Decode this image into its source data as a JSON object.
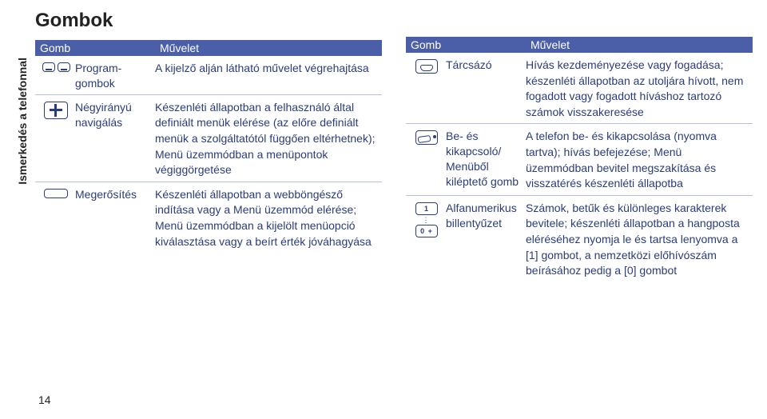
{
  "sideLabel": "Ismerkedés a telefonnal",
  "title": "Gombok",
  "headers": {
    "gomb": "Gomb",
    "muvelet": "Művelet"
  },
  "left": {
    "rows": [
      {
        "label": "Program-gombok",
        "op": "A kijelző alján látható művelet végrehajtása"
      },
      {
        "label": "Négyirányú navigálás",
        "op": "Készenléti állapotban a felhasználó által definiált menük elérése (az előre definiált menük a szolgáltatótól függően eltérhetnek); Menü üzemmódban a menüpontok végiggörgetése"
      },
      {
        "label": "Megerősítés",
        "op": "Készenléti állapotban a webböngésző indítása vagy a Menü üzemmód elérése; Menü üzemmódban a kijelölt menüopció kiválasztása vagy a beírt érték jóváhagyása"
      }
    ]
  },
  "right": {
    "rows": [
      {
        "label": "Tárcsázó",
        "op": "Hívás kezdeményezése vagy fogadása; készenléti állapotban az utoljára hívott, nem fogadott vagy fogadott híváshoz tartozó számok visszakeresése"
      },
      {
        "label": "Be- és kikapcsoló/ Menüből kiléptető gomb",
        "op": "A telefon be- és kikapcsolása (nyomva tartva); hívás befejezése; Menü üzemmódban bevitel megszakítása és visszatérés készenléti állapotba"
      },
      {
        "label": "Alfanumerikus billentyűzet",
        "op": "Számok, betűk és különleges karakterek bevitele; készenléti állapotban a hangposta eléréséhez nyomja le és tartsa lenyomva a [1] gombot, a nemzetközi előhívószám beírásához pedig a [0] gombot"
      }
    ]
  },
  "keys": {
    "num1": "1",
    "num0": "0 +"
  },
  "pageNumber": "14"
}
